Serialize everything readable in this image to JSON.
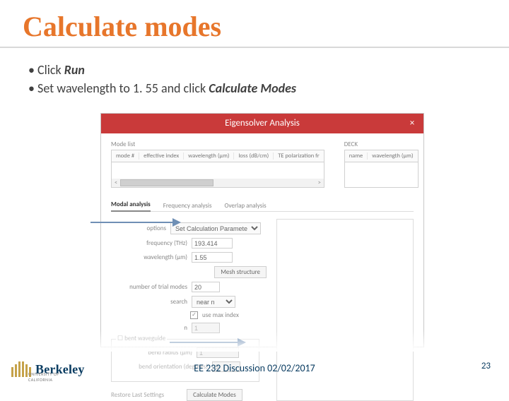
{
  "title": "Calculate modes",
  "bullets": {
    "line1_prefix": "Click ",
    "line1_bold": "Run",
    "line2_a": "Set wavelength to 1. 55 and click ",
    "line2_bold": "Calculate Modes"
  },
  "dialog": {
    "title": "Eigensolver Analysis",
    "close": "×",
    "modeList": {
      "label": "Mode list",
      "cols": [
        "mode #",
        "effective index",
        "wavelength (µm)",
        "loss (dB/cm)",
        "TE polarization fr"
      ]
    },
    "deck": {
      "label": "DECK",
      "cols": [
        "name",
        "wavelength (µm)"
      ]
    },
    "tabs": {
      "active": "Modal analysis",
      "t2": "Frequency analysis",
      "t3": "Overlap analysis"
    },
    "form": {
      "options_label": "options",
      "options_value": "Set Calculation Parameters",
      "freq_label": "frequency (THz)",
      "freq_value": "193.414",
      "wavelength_label": "wavelength (µm)",
      "wavelength_value": "1.55",
      "mesh_btn": "Mesh structure",
      "trial_label": "number of trial modes",
      "trial_value": "20",
      "search_label": "search",
      "search_value": "near n",
      "use_max_checked": "✓",
      "use_max_label": "use max index",
      "n_label": "n",
      "n_value": "1",
      "bend": {
        "legend_box": "☐",
        "legend_label": "bent waveguide",
        "radius_label": "bend radius (µm)",
        "radius_value": "1",
        "orient_label": "bend orientation (degrees)",
        "orient_value": "0"
      },
      "restore_btn": "Restore Last Settings",
      "calc_btn": "Calculate Modes"
    }
  },
  "footer": {
    "wordmark": "Berkeley",
    "sub": "UNIVERSITY OF CALIFORNIA",
    "center": "EE 232 Discussion 02/02/2017",
    "page": "23"
  }
}
